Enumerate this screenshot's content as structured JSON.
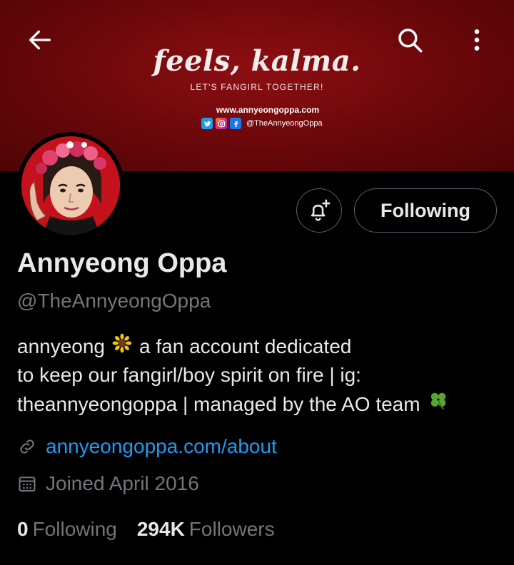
{
  "banner": {
    "title": "feels, kalma.",
    "subtitle": "LET'S FANGIRL TOGETHER!",
    "url": "www.annyeongoppa.com",
    "social_handle": "@TheAnnyeongOppa",
    "social_icons": [
      "twitter-icon",
      "instagram-icon",
      "facebook-icon"
    ]
  },
  "topbar": {
    "back_icon": "arrow-left-icon",
    "search_icon": "search-icon",
    "more_icon": "more-vertical-icon"
  },
  "actions": {
    "notify_icon": "bell-plus-icon",
    "follow_label": "Following"
  },
  "profile": {
    "name": "Annyeong Oppa",
    "handle": "@TheAnnyeongOppa",
    "bio_line1_a": "annyeong",
    "bio_line1_b": "a fan account dedicated",
    "bio_line2": "to keep our fangirl/boy spirit on fire | ig:",
    "bio_line3": "theannyeongoppa | managed by the AO team",
    "website": "annyeongoppa.com/about",
    "joined": "Joined April 2016"
  },
  "stats": {
    "following_count": "0",
    "following_label": "Following",
    "followers_count": "294K",
    "followers_label": "Followers"
  },
  "colors": {
    "accent": "#1d9bf0",
    "banner": "#7a0a0d",
    "muted": "#71767b"
  }
}
